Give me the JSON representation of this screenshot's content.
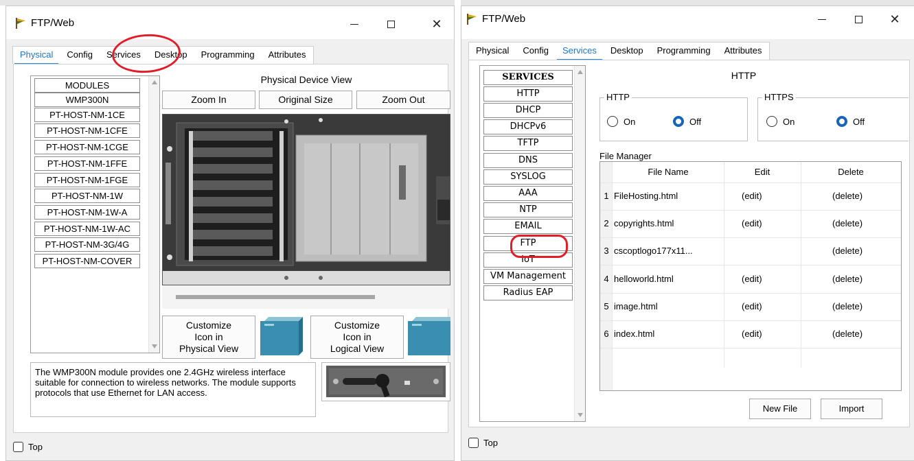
{
  "left_window": {
    "title": "FTP/Web",
    "window_controls": {
      "close_glyph": "✕"
    },
    "tabs": [
      {
        "label": "Physical",
        "active": true
      },
      {
        "label": "Config",
        "active": false
      },
      {
        "label": "Services",
        "active": false
      },
      {
        "label": "Desktop",
        "active": false
      },
      {
        "label": "Programming",
        "active": false
      },
      {
        "label": "Attributes",
        "active": false
      }
    ],
    "modules": [
      "MODULES",
      "WMP300N",
      "PT-HOST-NM-1CE",
      "PT-HOST-NM-1CFE",
      "PT-HOST-NM-1CGE",
      "PT-HOST-NM-1FFE",
      "PT-HOST-NM-1FGE",
      "PT-HOST-NM-1W",
      "PT-HOST-NM-1W-A",
      "PT-HOST-NM-1W-AC",
      "PT-HOST-NM-3G/4G",
      "PT-HOST-NM-COVER"
    ],
    "physical_device_view": "Physical Device View",
    "zoom_in": "Zoom In",
    "original_size": "Original Size",
    "zoom_out": "Zoom Out",
    "customize_physical": [
      "Customize",
      "Icon in",
      "Physical View"
    ],
    "customize_logical": [
      "Customize",
      "Icon in",
      "Logical View"
    ],
    "description": "The WMP300N module provides one 2.4GHz wireless interface suitable for connection to wireless networks. The module supports protocols that use Ethernet for LAN access.",
    "top_label": "Top"
  },
  "right_window": {
    "title": "FTP/Web",
    "window_controls": {
      "close_glyph": "✕"
    },
    "tabs": [
      {
        "label": "Physical",
        "active": false
      },
      {
        "label": "Config",
        "active": false
      },
      {
        "label": "Services",
        "active": true
      },
      {
        "label": "Desktop",
        "active": false
      },
      {
        "label": "Programming",
        "active": false
      },
      {
        "label": "Attributes",
        "active": false
      }
    ],
    "services": [
      "SERVICES",
      "HTTP",
      "DHCP",
      "DHCPv6",
      "TFTP",
      "DNS",
      "SYSLOG",
      "AAA",
      "NTP",
      "EMAIL",
      "FTP",
      "IoT",
      "VM Management",
      "Radius EAP"
    ],
    "panel_title": "HTTP",
    "http_group": {
      "label": "HTTP",
      "on": "On",
      "off": "Off",
      "selected": "Off"
    },
    "https_group": {
      "label": "HTTPS",
      "on": "On",
      "off": "Off",
      "selected": "Off"
    },
    "file_manager_label": "File Manager",
    "columns": [
      "File Name",
      "Edit",
      "Delete"
    ],
    "files": [
      {
        "num": "1",
        "name": "FileHosting.html",
        "edit": "(edit)",
        "delete": "(delete)"
      },
      {
        "num": "2",
        "name": "copyrights.html",
        "edit": "(edit)",
        "delete": "(delete)"
      },
      {
        "num": "3",
        "name": "cscoptlogo177x11...",
        "edit": "",
        "delete": "(delete)"
      },
      {
        "num": "4",
        "name": "helloworld.html",
        "edit": "(edit)",
        "delete": "(delete)"
      },
      {
        "num": "5",
        "name": "image.html",
        "edit": "(edit)",
        "delete": "(delete)"
      },
      {
        "num": "6",
        "name": "index.html",
        "edit": "(edit)",
        "delete": "(delete)"
      }
    ],
    "new_file": "New File",
    "import": "Import",
    "top_label": "Top"
  },
  "colors": {
    "accent": "#1b77c9",
    "annotation": "#e11d2a",
    "radio_selected": "#1764b8"
  }
}
